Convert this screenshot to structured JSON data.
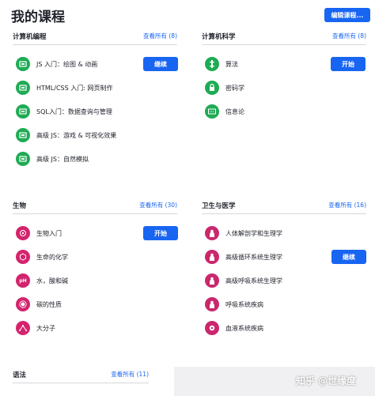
{
  "page": {
    "title": "我的课程",
    "edit_button": "编辑课程..."
  },
  "sections": {
    "cs_programming": {
      "title": "计算机编程",
      "link": "查看所有 (8)",
      "items": [
        {
          "label": "JS 入门：绘图 & 动画",
          "icon": "code-icon",
          "button": "继续"
        },
        {
          "label": "HTML/CSS 入门: 网页制作",
          "icon": "code-icon"
        },
        {
          "label": "SQL入门：数据查询与管理",
          "icon": "code-icon"
        },
        {
          "label": "高级 JS：游戏 & 可视化效果",
          "icon": "code-icon"
        },
        {
          "label": "高级 JS：自然模拟",
          "icon": "code-icon"
        }
      ]
    },
    "cs_science": {
      "title": "计算机科学",
      "link": "查看所有 (8)",
      "items": [
        {
          "label": "算法",
          "icon": "algorithm-icon",
          "button": "开始"
        },
        {
          "label": "密码学",
          "icon": "lock-icon"
        },
        {
          "label": "信息论",
          "icon": "signal-icon"
        }
      ]
    },
    "biology": {
      "title": "生物",
      "link": "查看所有 (30)",
      "items": [
        {
          "label": "生物入门",
          "icon": "cell-icon",
          "button": "开始"
        },
        {
          "label": "生命的化学",
          "icon": "molecule-icon"
        },
        {
          "label": "水，酸和碱",
          "icon": "ph-icon",
          "badge": "pH"
        },
        {
          "label": "碳的性质",
          "icon": "carbon-icon"
        },
        {
          "label": "大分子",
          "icon": "macromolecule-icon"
        }
      ]
    },
    "health": {
      "title": "卫生与医学",
      "link": "查看所有 (16)",
      "items": [
        {
          "label": "人体解剖学和生理学",
          "icon": "body-icon"
        },
        {
          "label": "高级循环系统生理学",
          "icon": "heart-icon",
          "button": "继续"
        },
        {
          "label": "高级呼吸系统生理学",
          "icon": "lungs-icon"
        },
        {
          "label": "呼吸系统疾病",
          "icon": "lungs-disease-icon"
        },
        {
          "label": "血液系统疾病",
          "icon": "blood-icon"
        }
      ]
    },
    "grammar": {
      "title": "语法",
      "link": "查看所有 (11)"
    }
  },
  "watermark": "知乎 @世缘度",
  "colors": {
    "accent": "#1865f2",
    "cs_green": "#1fab54",
    "bio_pink": "#d4246d",
    "text": "#21242c",
    "divider": "#d6d8da"
  }
}
